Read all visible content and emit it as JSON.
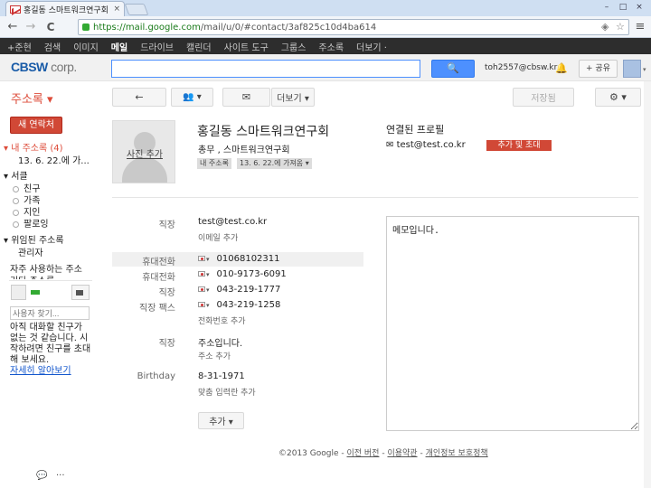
{
  "browser": {
    "tab_title": "홍길동 스마트워크연구회",
    "tab_close": "×",
    "url_host": "https://mail.google.com",
    "url_path": "/mail/u/0/#contact/3af825c10d4ba614",
    "win_min": "–",
    "win_max": "□",
    "win_close": "×",
    "back": "←",
    "forward": "→",
    "reload": "C",
    "star": "☆",
    "menu": "≡"
  },
  "gbar": {
    "items": [
      "+준현",
      "검색",
      "이미지",
      "메일",
      "드라이브",
      "캘린더",
      "사이트 도구",
      "그룹스",
      "주소록",
      "더보기 ·"
    ]
  },
  "header": {
    "logo_main": "CBSW",
    "logo_sub": " corp.",
    "search_placeholder": "",
    "search_btn": "🔍",
    "account": "toh2557@cbsw.kr",
    "bell": "🔔",
    "share": "+ 공유",
    "avatar_caret": "▾"
  },
  "toolbar": {
    "title": "주소록 ▾",
    "back": "←",
    "people": "👥 ▾",
    "mail": "✉",
    "more": "더보기 ▾",
    "save": "저장됨",
    "settings": "⚙ ▾"
  },
  "sidebar": {
    "new_contact": "새 연락처",
    "my_contacts": "▾ 내 주소록 (4)",
    "recent": "13. 6. 22.에 가...",
    "circles": "▾ 서클",
    "circle_items": [
      "친구",
      "가족",
      "지인",
      "팔로잉"
    ],
    "delegated": "▾ 위임된 주소록",
    "admin": "관리자",
    "frequent": "자주 사용하는 주소",
    "other": "기타 주소록",
    "chat_search": "사용자 찾기...",
    "chat_msg": "아직 대화할 친구가 없는 것 같습니다. 시작하려면 친구를 초대해 보세요.",
    "chat_link": "자세히 알아보기",
    "chat_icon": "💬",
    "dots": "···"
  },
  "contact": {
    "photo_label": "사진 추가",
    "name": "홍길동 스마트워크연구회",
    "org": "총무   , 스마트워크연구회",
    "chip1": "내 주소록",
    "chip2": "13. 6. 22.에 가져옴 ▾",
    "linked_title": "연결된 프로필",
    "linked_email": "test@test.co.kr",
    "add_invite": "추가 및 초대"
  },
  "fields": {
    "email_label": "직장",
    "email": "test@test.co.kr",
    "email_add": "이메일 추가",
    "phones": [
      {
        "label": "휴대전화",
        "value": "01068102311"
      },
      {
        "label": "휴대전화",
        "value": "010-9173-6091"
      },
      {
        "label": "직장",
        "value": "043-219-1777"
      },
      {
        "label": "직장 팩스",
        "value": "043-219-1258"
      }
    ],
    "phone_add": "전화번호 추가",
    "addr_label": "직장",
    "addr": "주소입니다.",
    "addr_add": "주소 추가",
    "bday_label": "Birthday",
    "bday": "8-31-1971",
    "custom_add": "맞춤 입력란 추가",
    "add_btn": "추가 ▾",
    "notes": "메모입니다."
  },
  "footer": {
    "copy": "©2013 Google - ",
    "links": [
      "이전 버전",
      "이용약관",
      "개인정보 보호정책"
    ],
    "sep": " - "
  }
}
